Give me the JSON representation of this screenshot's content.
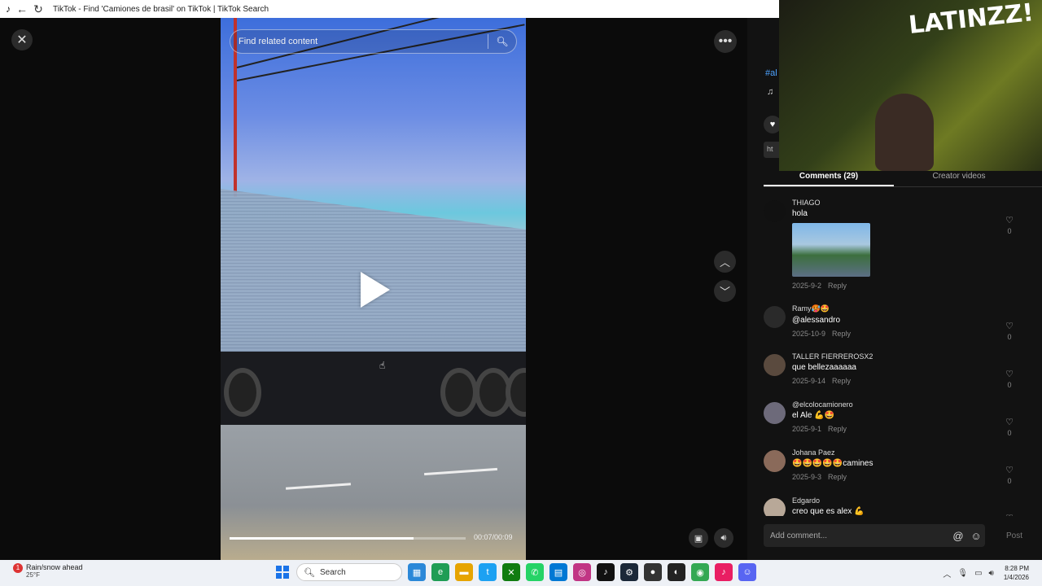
{
  "browser": {
    "title": "TikTok - Find 'Camiones de brasil' on TikTok | TikTok Search"
  },
  "video": {
    "search_placeholder": "Find related content",
    "time": "00:07/00:09",
    "progress_fraction": 0.78
  },
  "panel": {
    "hashtag_partial": "#al",
    "link_partial": "ht",
    "tabs": {
      "comments": "Comments (29)",
      "creator": "Creator videos"
    },
    "comments": [
      {
        "user": "THIAGO",
        "text": "hola",
        "date": "2025-9-2",
        "reply": "Reply",
        "likes": "0",
        "has_image": true
      },
      {
        "user": "Ramy🥵🤩",
        "text": "@alessandro",
        "date": "2025-10-9",
        "reply": "Reply",
        "likes": "0"
      },
      {
        "user": "TALLER FIERREROSX2",
        "text": "que bellezaaaaaa",
        "date": "2025-9-14",
        "reply": "Reply",
        "likes": "0"
      },
      {
        "user": "@elcolocamionero",
        "text": "el Ale 💪🤩",
        "date": "2025-9-1",
        "reply": "Reply",
        "likes": "0"
      },
      {
        "user": "Johana Paez",
        "text": "🤩🤩🤩🤩🤩camines",
        "date": "2025-9-3",
        "reply": "Reply",
        "likes": "0"
      },
      {
        "user": "Edgardo",
        "text": "creo que es alex 💪",
        "date": "",
        "reply": "",
        "likes": ""
      }
    ],
    "add_comment_placeholder": "Add comment...",
    "post_label": "Post"
  },
  "webcam": {
    "logo": "LATINZZ!"
  },
  "taskbar": {
    "weather_text": "Rain/snow ahead",
    "weather_temp": "25°F",
    "weather_badge": "1",
    "search_label": "Search",
    "time": "8:28 PM",
    "date": "1/4/2026"
  }
}
